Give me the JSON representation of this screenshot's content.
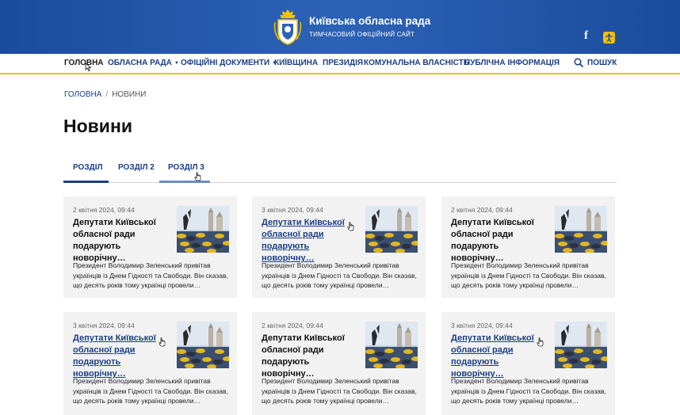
{
  "header": {
    "title": "Київська обласна рада",
    "subtitle": "ТИМЧАСОВИЙ ОФІЦІЙНИЙ САЙТ",
    "facebook_glyph": "f",
    "icons": [
      "coat-of-arms-logo",
      "facebook-icon",
      "accessibility-icon"
    ]
  },
  "nav": {
    "items": [
      {
        "label": "ГОЛОВНА"
      },
      {
        "label": "ОБЛАСНА РАДА"
      },
      {
        "label": "ОФІЦІЙНІ ДОКУМЕНТИ"
      },
      {
        "label": "КИЇВЩИНА"
      },
      {
        "label": "ПРЕЗИДІЯ"
      },
      {
        "label": "КОМУНАЛЬНА ВЛАСНІСТЬ"
      },
      {
        "label": "ПУБЛІЧНА ІНФОРМАЦІЯ"
      }
    ],
    "search_label": "ПОШУК"
  },
  "breadcrumb": {
    "home": "ГОЛОВНА",
    "separator": "/",
    "current": "НОВИНИ"
  },
  "page": {
    "title": "Новини"
  },
  "tabs": [
    {
      "label": "РОЗДІЛ"
    },
    {
      "label": "РОЗДІЛ 2"
    },
    {
      "label": "РОЗДІЛ 3"
    }
  ],
  "cards": [
    {
      "date": "2 квітня 2024, 09:44",
      "title": "Депутати Київської обласної ради подарують новорічну…",
      "excerpt": "Президент Володимир Зеленський привітав українців із Днем Гідності та Свободи. Він сказав, що десять років тому українці провели…"
    },
    {
      "date": "3 квітня 2024, 09:44",
      "title": "Депутати Київської обласної ради подарують новорічну…",
      "excerpt": "Президент Володимир Зеленський привітав українців із Днем Гідності та Свободи. Він сказав, що десять років тому українці провели…"
    },
    {
      "date": "2 квітня 2024, 09:44",
      "title": "Депутати Київської обласної ради подарують новорічну…",
      "excerpt": "Президент Володимир Зеленський привітав українців із Днем Гідності та Свободи. Він сказав, що десять років тому українці провели…"
    },
    {
      "date": "3 квітня 2024, 09:44",
      "title": "Депутати Київської обласної ради подарують новорічну…",
      "excerpt": "Президент Володимир Зеленський привітав українців із Днем Гідності та Свободи. Він сказав, що десять років тому українці провели…"
    },
    {
      "date": "2 квітня 2024, 09:44",
      "title": "Депутати Київської обласної ради подарують новорічну…",
      "excerpt": "Президент Володимир Зеленський привітав українців із Днем Гідності та Свободи. Він сказав, що десять років тому українці провели…"
    },
    {
      "date": "3 квітня 2024, 09:44",
      "title": "Депутати Київської обласної ради подарують новорічну…",
      "excerpt": "Президент Володимир Зеленський привітав українців із Днем Гідності та Свободи. Він сказав, що десять років тому українці провели…"
    }
  ],
  "colors": {
    "brand_blue": "#1b4c9c",
    "link_blue": "#1b3e86",
    "accent_yellow": "#f3c000",
    "card_bg": "#f2f2f2"
  }
}
